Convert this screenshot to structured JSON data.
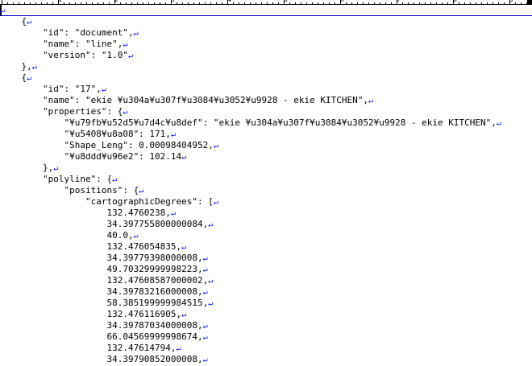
{
  "ruler": {
    "numbers": [
      "1",
      "2",
      "3",
      "4",
      "5",
      "6",
      "7",
      "8",
      "9"
    ]
  },
  "editor": {
    "return_mark": "↵",
    "lines": [
      "",
      "    {",
      "        \"id\": \"document\",",
      "        \"name\": \"line\",",
      "        \"version\": \"1.0\"",
      "    },",
      "    {",
      "        \"id\": \"17\",",
      "        \"name\": \"ekie ¥u304a¥u307f¥u3084¥u3052¥u9928 - ekie KITCHEN\",",
      "        \"properties\": {",
      "            \"¥u79fb¥u52d5¥u7d4c¥u8def\": \"ekie ¥u304a¥u307f¥u3084¥u3052¥u9928 - ekie KITCHEN\",",
      "            \"¥u5408¥u8a08\": 171,",
      "            \"Shape_Leng\": 0.00098404952,",
      "            \"¥u8ddd¥u96e2\": 102.14",
      "        },",
      "        \"polyline\": {",
      "            \"positions\": {",
      "                \"cartographicDegrees\": [",
      "                    132.4760238,",
      "                    34.397755800000084,",
      "                    40.0,",
      "                    132.476054835,",
      "                    34.39779398000008,",
      "                    49.70329999998223,",
      "                    132.47608587000002,",
      "                    34.39783216000008,",
      "                    58.385199999984515,",
      "                    132.476116905,",
      "                    34.39787034000008,",
      "                    66.04569999998674,",
      "                    132.47614794,",
      "                    34.39790852000008,"
    ]
  }
}
